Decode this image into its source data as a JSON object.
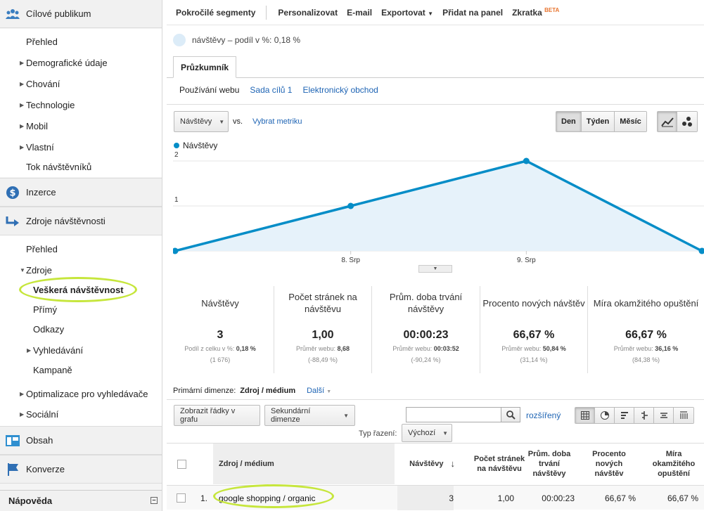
{
  "sidebar": {
    "audience": {
      "label": "Cílové publikum",
      "icon": "people-icon"
    },
    "audience_items": [
      {
        "label": "Přehled",
        "arrow": false
      },
      {
        "label": "Demografické údaje",
        "arrow": true
      },
      {
        "label": "Chování",
        "arrow": true
      },
      {
        "label": "Technologie",
        "arrow": true
      },
      {
        "label": "Mobil",
        "arrow": true
      },
      {
        "label": "Vlastní",
        "arrow": true
      },
      {
        "label": "Tok návštěvníků",
        "arrow": false
      }
    ],
    "advertising": {
      "label": "Inzerce",
      "icon": "dollar-icon"
    },
    "acquisition": {
      "label": "Zdroje návštěvnosti",
      "icon": "arrows-icon"
    },
    "acquisition_items": {
      "overview": "Přehled",
      "sources": "Zdroje",
      "all_traffic": "Veškerá návštěvnost",
      "direct": "Přímý",
      "referrals": "Odkazy",
      "search": "Vyhledávání",
      "campaigns": "Kampaně",
      "seo": "Optimalizace pro vyhledávače",
      "social": "Sociální"
    },
    "content": {
      "label": "Obsah",
      "icon": "content-icon"
    },
    "conversions": {
      "label": "Konverze",
      "icon": "flag-icon"
    },
    "help": {
      "label": "Nápověda",
      "collapse": "–"
    }
  },
  "toolbar": {
    "advanced_segments": "Pokročilé segmenty",
    "customize": "Personalizovat",
    "email": "E-mail",
    "export": "Exportovat",
    "export_caret": "▼",
    "add_dashboard": "Přidat na panel",
    "shortcut": "Zkratka",
    "beta": "BETA"
  },
  "segment": {
    "text": "návštěvy – podíl v %: 0,18 %"
  },
  "tabs": {
    "explorer": "Průzkumník"
  },
  "subtabs": {
    "site_usage": "Používání webu",
    "goal_set": "Sada cílů 1",
    "ecommerce": "Elektronický obchod"
  },
  "chart_controls": {
    "metric": "Návštěvy",
    "vs": "vs.",
    "select_metric": "Vybrat metriku",
    "periods": [
      "Den",
      "Týden",
      "Měsíc"
    ],
    "active_period": "Den"
  },
  "chart_data": {
    "type": "line",
    "series": [
      {
        "name": "Návštěvy",
        "color": "#058dc7",
        "values": [
          0,
          1,
          2,
          0
        ]
      }
    ],
    "x": [
      "",
      "8. Srp",
      "9. Srp",
      ""
    ],
    "ytick_labels": [
      "1",
      "2"
    ],
    "ylim": [
      0,
      2
    ],
    "grid": true,
    "legend": "top-left"
  },
  "scorecards": [
    {
      "label": "Návštěvy",
      "value": "3",
      "sub_label": "Podíl z celku v %:",
      "sub_value": "0,18 %",
      "pct": "(1 676)"
    },
    {
      "label": "Počet stránek na návštěvu",
      "value": "1,00",
      "sub_label": "Průměr webu:",
      "sub_value": "8,68",
      "pct": "(-88,49 %)"
    },
    {
      "label": "Prům. doba trvání návštěvy",
      "value": "00:00:23",
      "sub_label": "Průměr webu:",
      "sub_value": "00:03:52",
      "pct": "(-90,24 %)"
    },
    {
      "label": "Procento nových návštěv",
      "value": "66,67 %",
      "sub_label": "Průměr webu:",
      "sub_value": "50,84 %",
      "pct": "(31,14 %)"
    },
    {
      "label": "Míra okamžitého opuštění",
      "value": "66,67 %",
      "sub_label": "Průměr webu:",
      "sub_value": "36,16 %",
      "pct": "(84,38 %)"
    }
  ],
  "dimension": {
    "label": "Primární dimenze:",
    "value": "Zdroj / médium",
    "more": "Další",
    "more_caret": "▼"
  },
  "table_bar": {
    "plot_rows": "Zobrazit řádky v grafu",
    "secondary_dim": "Sekundární dimenze",
    "advanced": "rozšířený",
    "sort_label": "Typ řazení:",
    "sort_value": "Výchozí"
  },
  "table": {
    "headers": {
      "dim": "Zdroj / médium",
      "visits": "Návštěvy",
      "sort_arrow": "↓",
      "pages": "Počet stránek na návštěvu",
      "duration": "Prům. doba trvání návštěvy",
      "new_visits": "Procento nových návštěv",
      "bounce": "Míra okamžitého opuštění"
    },
    "rows": [
      {
        "index": "1.",
        "dim": "google shopping / organic",
        "visits": "3",
        "pages": "1,00",
        "duration": "00:00:23",
        "new_visits": "66,67 %",
        "bounce": "66,67 %"
      }
    ]
  }
}
